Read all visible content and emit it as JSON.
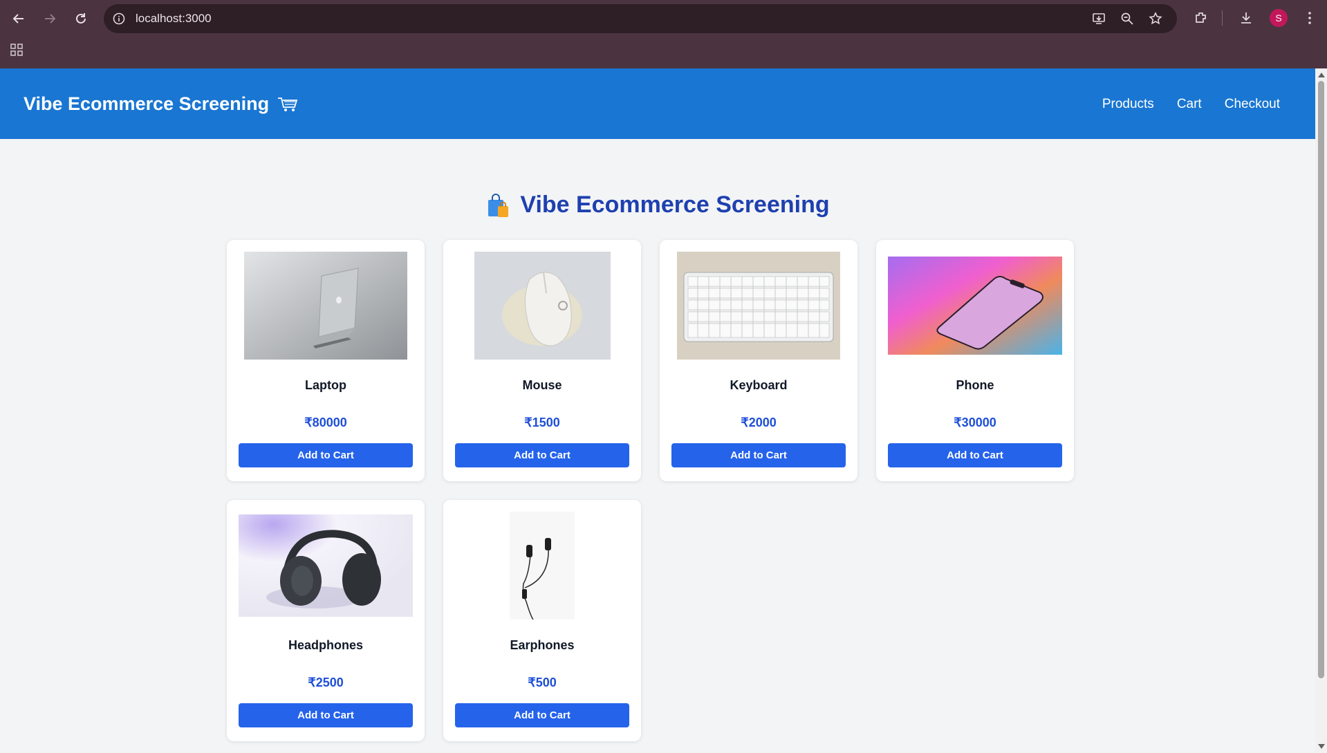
{
  "browser": {
    "url": "localhost:3000",
    "avatar_letter": "S"
  },
  "header": {
    "brand": "Vibe Ecommerce Screening",
    "brand_icon": "shopping-cart-icon",
    "nav": [
      "Products",
      "Cart",
      "Checkout"
    ]
  },
  "page": {
    "title": "Vibe Ecommerce Screening",
    "title_icon": "shopping-bags-icon",
    "add_label": "Add to Cart",
    "products": [
      {
        "name": "Laptop",
        "price": "₹80000",
        "image": "laptop-image"
      },
      {
        "name": "Mouse",
        "price": "₹1500",
        "image": "mouse-image"
      },
      {
        "name": "Keyboard",
        "price": "₹2000",
        "image": "keyboard-image"
      },
      {
        "name": "Phone",
        "price": "₹30000",
        "image": "phone-image"
      },
      {
        "name": "Headphones",
        "price": "₹2500",
        "image": "headphones-image"
      },
      {
        "name": "Earphones",
        "price": "₹500",
        "image": "earphones-image"
      }
    ]
  },
  "colors": {
    "header_bg": "#1976d2",
    "title": "#1e40af",
    "price": "#1d4ed8",
    "button": "#2563eb",
    "page_bg": "#f3f4f6"
  }
}
